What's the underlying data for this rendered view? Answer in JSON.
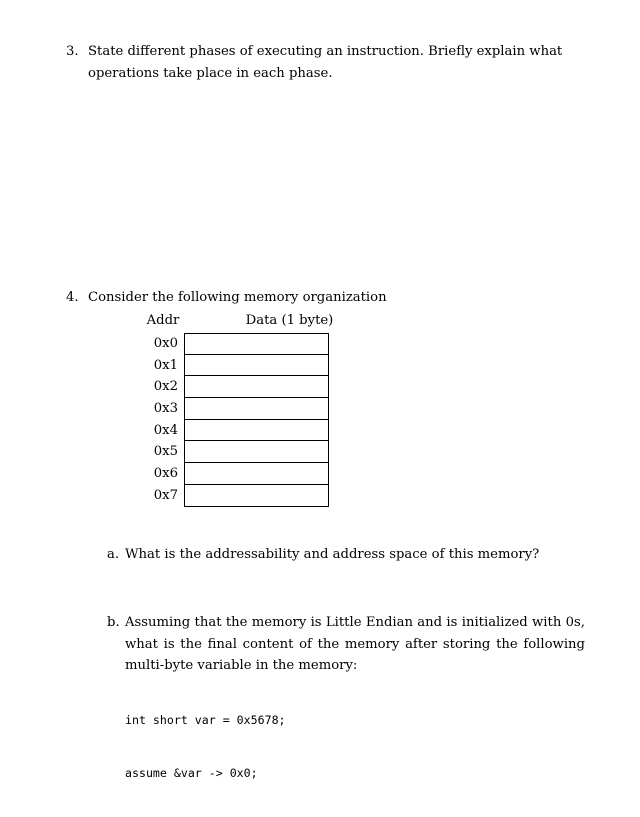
{
  "document": {
    "background_color": "#ffffff",
    "text_color": "#000000"
  },
  "questions": [
    {
      "marker": "3.",
      "text": "State different phases of executing an instruction. Briefly explain what operations take place in each phase."
    },
    {
      "marker": "4.",
      "text": "Consider the following memory organization"
    }
  ],
  "memory_table": {
    "headers": {
      "address": "Addr",
      "data": "Data (1 byte)"
    },
    "rows": [
      {
        "address": "0x0",
        "data": ""
      },
      {
        "address": "0x1",
        "data": ""
      },
      {
        "address": "0x2",
        "data": ""
      },
      {
        "address": "0x3",
        "data": ""
      },
      {
        "address": "0x4",
        "data": ""
      },
      {
        "address": "0x5",
        "data": ""
      },
      {
        "address": "0x6",
        "data": ""
      },
      {
        "address": "0x7",
        "data": ""
      }
    ]
  },
  "subparts": [
    {
      "marker": "a.",
      "text": "What is the addressability and address space of this memory?"
    },
    {
      "marker": "b.",
      "text": "Assuming that the memory is Little Endian and is initialized with 0s, what is the final content of the memory after storing the following multi-byte variable in the memory:"
    }
  ],
  "code": {
    "line1": "int short var = 0x5678;",
    "line2": "assume &var -> 0x0;"
  }
}
